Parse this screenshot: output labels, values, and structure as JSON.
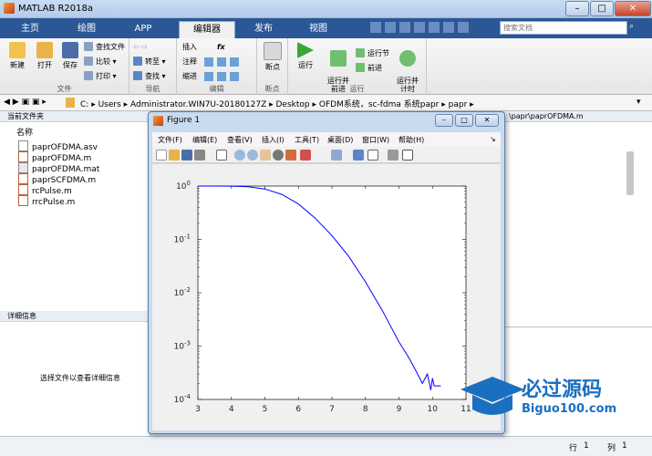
{
  "window": {
    "title": "MATLAB R2018a"
  },
  "tabs": [
    "主页",
    "绘图",
    "APP",
    "编辑器",
    "发布",
    "视图"
  ],
  "search": {
    "placeholder": "搜索文档"
  },
  "ribbon": {
    "file": {
      "new": "新建",
      "open": "打开",
      "save": "保存",
      "find_files": "查找文件",
      "compare": "比较",
      "print": "打印",
      "group": "文件"
    },
    "navigate": {
      "goto": "转至",
      "find": "查找",
      "group": "导航"
    },
    "edit": {
      "insert": "插入",
      "comment": "注释",
      "indent": "缩进",
      "fx": "fx",
      "group": "编辑"
    },
    "breakpoints": {
      "label": "断点",
      "group": "断点"
    },
    "run": {
      "run": "运行",
      "run_advance": "运行并\n前进",
      "run_section": "运行节",
      "advance": "前进",
      "run_time": "运行并\n计时",
      "group": "运行"
    }
  },
  "path": [
    "C:",
    "Users",
    "Administrator.WIN7U-20180127Z",
    "Desktop",
    "OFDM系统，sc-fdma 系统papr",
    "papr"
  ],
  "editor_path": "\\papr\\paprOFDMA.m",
  "current_folder": {
    "title": "当前文件夹",
    "col_name": "名称",
    "files": [
      "paprOFDMA.asv",
      "paprOFDMA.m",
      "paprOFDMA.mat",
      "paprSCFDMA.m",
      "rcPulse.m",
      "rrcPulse.m"
    ]
  },
  "details": {
    "title": "详细信息",
    "message": "选择文件以查看详细信息"
  },
  "status": {
    "row_label": "行",
    "row": "1",
    "col_label": "列",
    "col": "1"
  },
  "figure": {
    "title": "Figure 1",
    "menu": [
      "文件(F)",
      "编辑(E)",
      "查看(V)",
      "插入(I)",
      "工具(T)",
      "桌面(D)",
      "窗口(W)",
      "帮助(H)"
    ]
  },
  "watermark": {
    "line1": "必过源码",
    "line2": "Biguo100.com"
  },
  "chart_data": {
    "type": "line",
    "title": "",
    "xlabel": "",
    "ylabel": "",
    "xlim": [
      3,
      11
    ],
    "ylim": [
      0.0001,
      1
    ],
    "yscale": "log",
    "xticks": [
      3,
      4,
      5,
      6,
      7,
      8,
      9,
      10,
      11
    ],
    "yticks": [
      {
        "value": 1,
        "label": "10",
        "exp": "0"
      },
      {
        "value": 0.1,
        "label": "10",
        "exp": "-1"
      },
      {
        "value": 0.01,
        "label": "10",
        "exp": "-2"
      },
      {
        "value": 0.001,
        "label": "10",
        "exp": "-3"
      },
      {
        "value": 0.0001,
        "label": "10",
        "exp": "-4"
      }
    ],
    "grid": false,
    "color": "#0000ff",
    "series": [
      {
        "x": [
          3.0,
          3.5,
          4.0,
          4.5,
          5.0,
          5.5,
          6.0,
          6.5,
          7.0,
          7.5,
          8.0,
          8.5,
          9.0,
          9.3,
          9.5,
          9.7,
          9.85,
          9.95,
          10.0,
          10.05,
          10.25
        ],
        "y": [
          1.0,
          1.0,
          0.995,
          0.97,
          0.88,
          0.7,
          0.46,
          0.25,
          0.118,
          0.048,
          0.016,
          0.0047,
          0.0012,
          0.0006,
          0.00035,
          0.0002,
          0.0003,
          0.00015,
          0.00025,
          0.00018,
          0.00018
        ]
      }
    ]
  }
}
